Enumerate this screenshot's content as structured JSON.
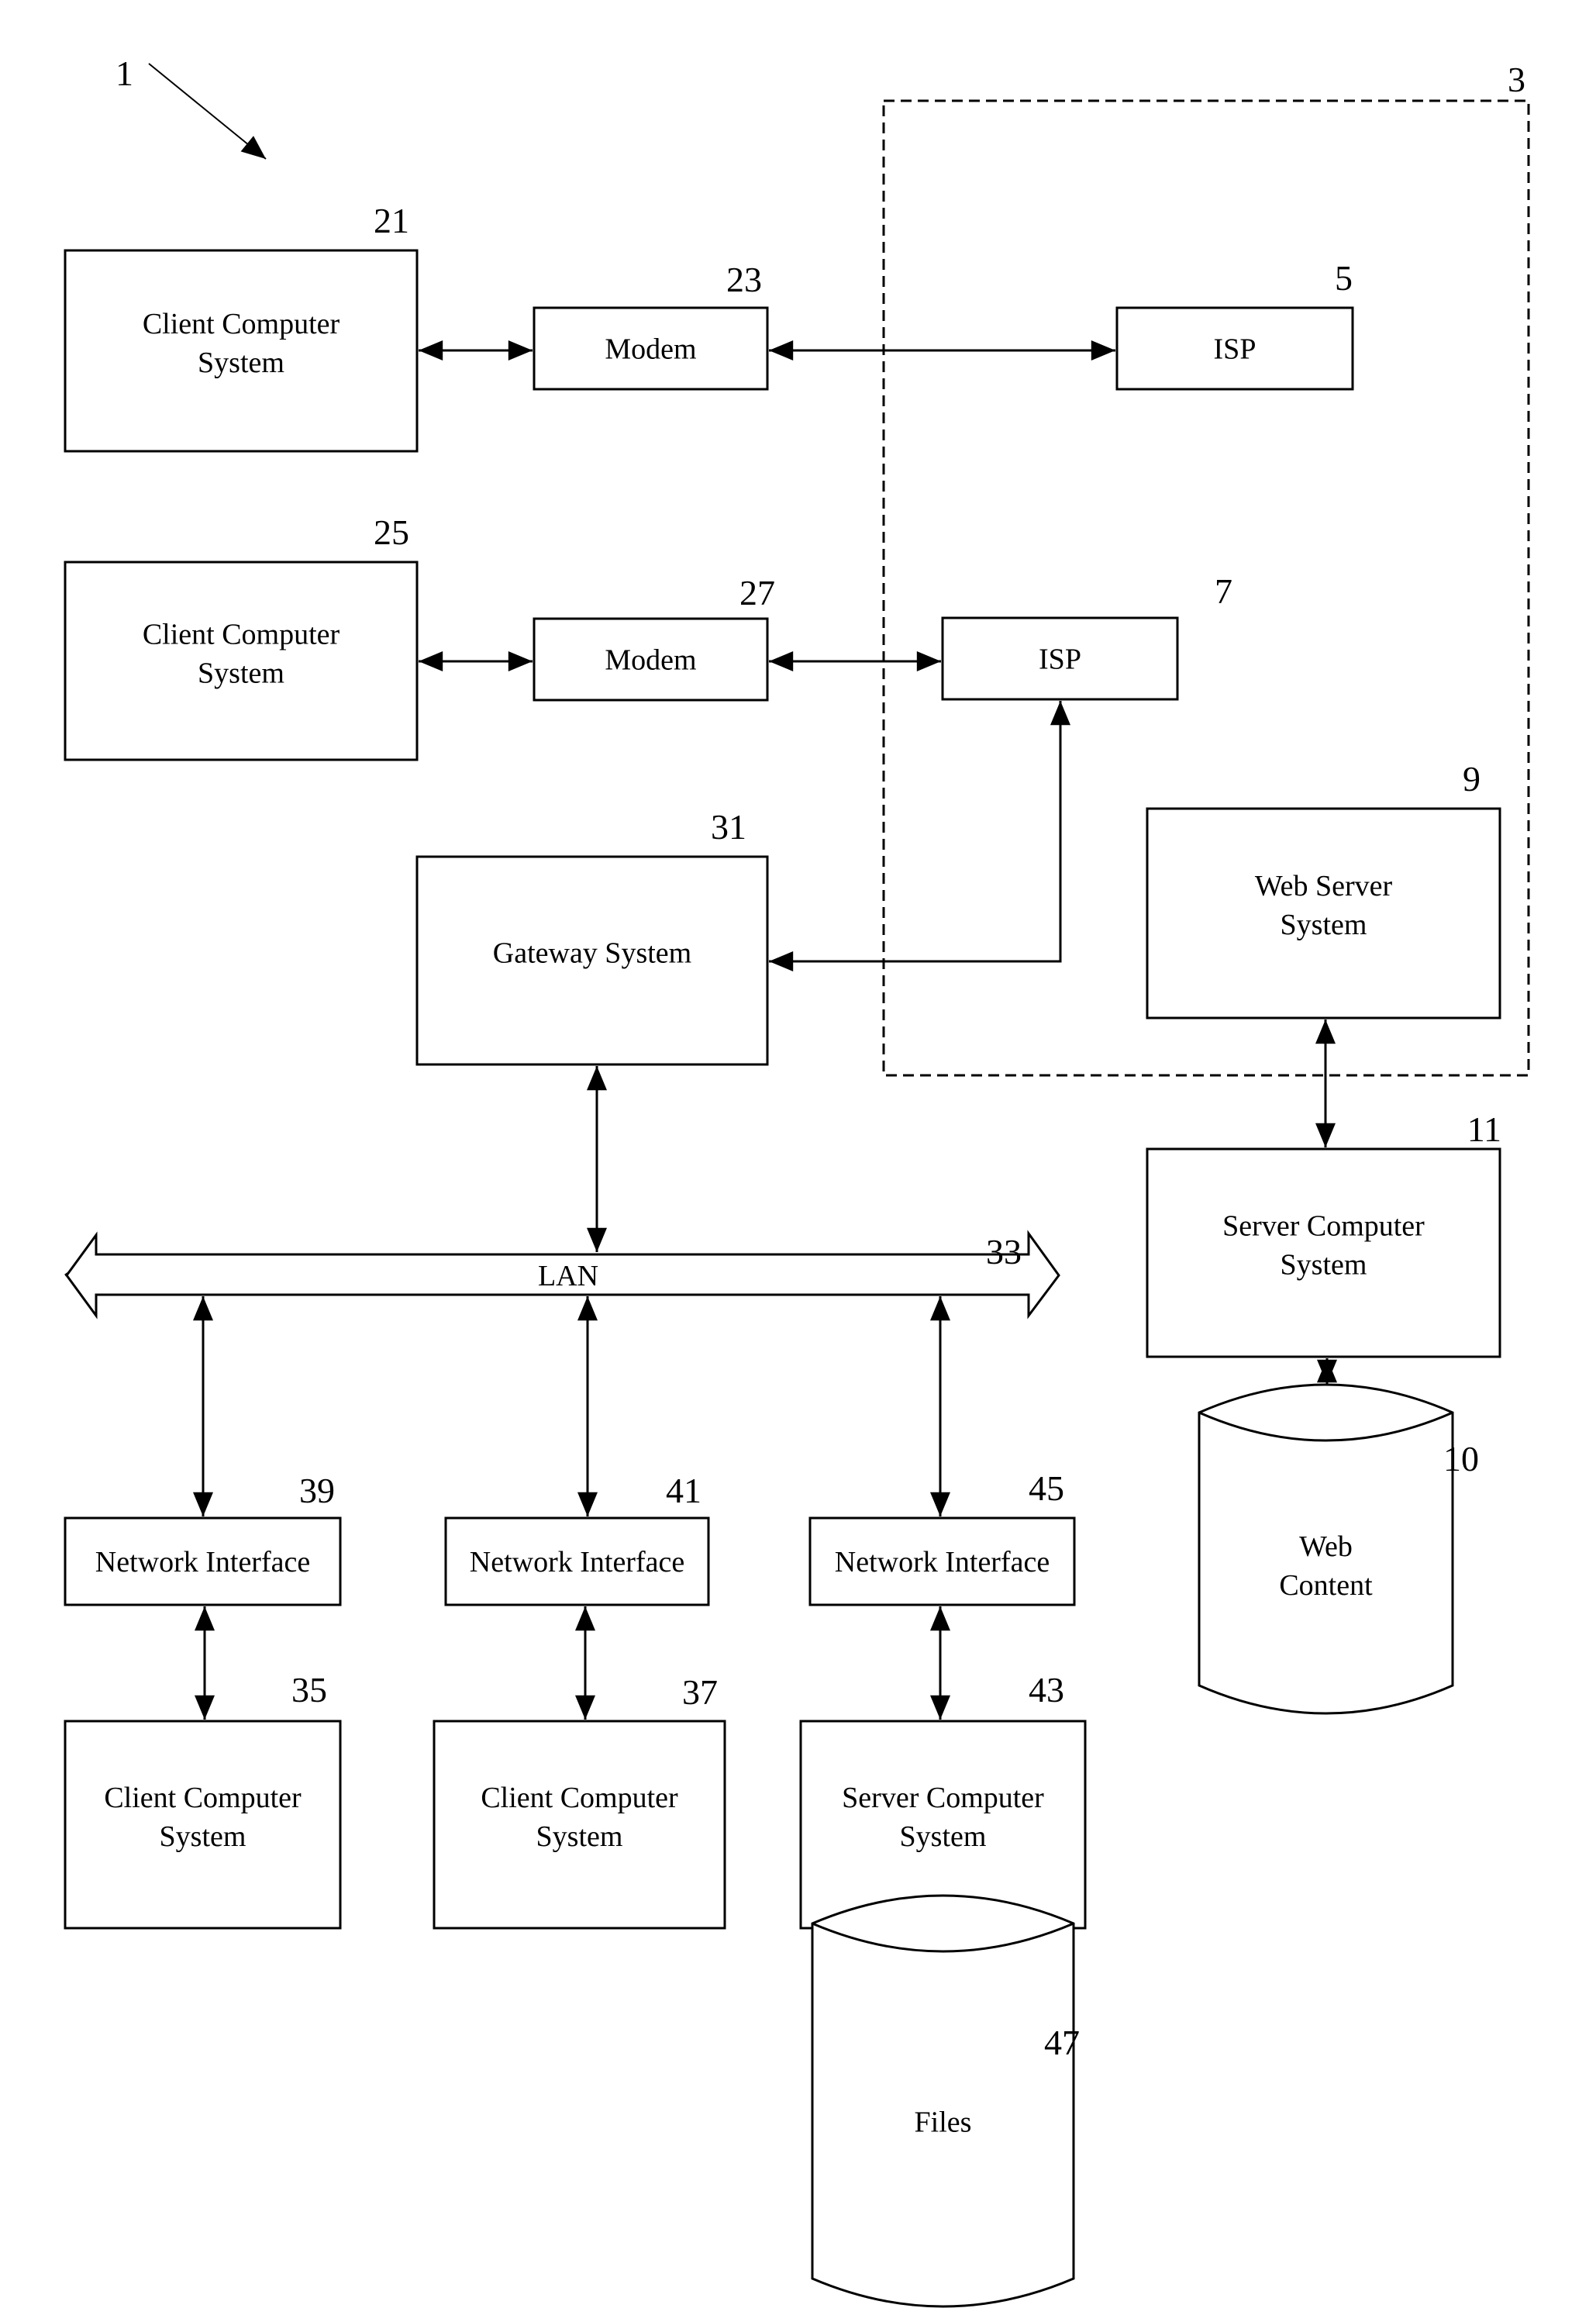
{
  "figure": {
    "reference": "1",
    "colors": {
      "stroke": "#000000",
      "background": "#ffffff"
    }
  },
  "internet_region": {
    "ref": "3"
  },
  "nodes": {
    "client_21": {
      "ref": "21",
      "lines": [
        "Client Computer",
        "System"
      ]
    },
    "modem_23": {
      "ref": "23",
      "lines": [
        "Modem"
      ]
    },
    "isp_5": {
      "ref": "5",
      "lines": [
        "ISP"
      ]
    },
    "client_25": {
      "ref": "25",
      "lines": [
        "Client Computer",
        "System"
      ]
    },
    "modem_27": {
      "ref": "27",
      "lines": [
        "Modem"
      ]
    },
    "isp_7": {
      "ref": "7",
      "lines": [
        "ISP"
      ]
    },
    "gateway_31": {
      "ref": "31",
      "lines": [
        "Gateway System"
      ]
    },
    "web_server_9": {
      "ref": "9",
      "lines": [
        "Web Server",
        "System"
      ]
    },
    "server_11": {
      "ref": "11",
      "lines": [
        "Server Computer",
        "System"
      ]
    },
    "web_content_10": {
      "ref": "10",
      "lines": [
        "Web",
        "Content"
      ]
    },
    "lan_33": {
      "ref": "33",
      "lines": [
        "LAN"
      ]
    },
    "netif_39": {
      "ref": "39",
      "lines": [
        "Network Interface"
      ]
    },
    "netif_41": {
      "ref": "41",
      "lines": [
        "Network Interface"
      ]
    },
    "netif_45": {
      "ref": "45",
      "lines": [
        "Network Interface"
      ]
    },
    "client_35": {
      "ref": "35",
      "lines": [
        "Client Computer",
        "System"
      ]
    },
    "client_37": {
      "ref": "37",
      "lines": [
        "Client Computer",
        "System"
      ]
    },
    "server_43": {
      "ref": "43",
      "lines": [
        "Server Computer",
        "System"
      ]
    },
    "files_47": {
      "ref": "47",
      "lines": [
        "Files"
      ]
    }
  },
  "connections": [
    {
      "from": "client_21",
      "to": "modem_23",
      "type": "bidirectional"
    },
    {
      "from": "modem_23",
      "to": "isp_5",
      "type": "bidirectional"
    },
    {
      "from": "client_25",
      "to": "modem_27",
      "type": "bidirectional"
    },
    {
      "from": "modem_27",
      "to": "isp_7",
      "type": "bidirectional"
    },
    {
      "from": "gateway_31",
      "to": "isp_7",
      "type": "bidirectional"
    },
    {
      "from": "gateway_31",
      "to": "lan_33",
      "type": "bidirectional"
    },
    {
      "from": "web_server_9",
      "to": "server_11",
      "type": "bidirectional"
    },
    {
      "from": "server_11",
      "to": "web_content_10",
      "type": "bidirectional"
    },
    {
      "from": "lan_33",
      "to": "netif_39",
      "type": "bidirectional"
    },
    {
      "from": "lan_33",
      "to": "netif_41",
      "type": "bidirectional"
    },
    {
      "from": "lan_33",
      "to": "netif_45",
      "type": "bidirectional"
    },
    {
      "from": "netif_39",
      "to": "client_35",
      "type": "bidirectional"
    },
    {
      "from": "netif_41",
      "to": "client_37",
      "type": "bidirectional"
    },
    {
      "from": "netif_45",
      "to": "server_43",
      "type": "bidirectional"
    },
    {
      "from": "server_43",
      "to": "files_47",
      "type": "bidirectional"
    }
  ]
}
